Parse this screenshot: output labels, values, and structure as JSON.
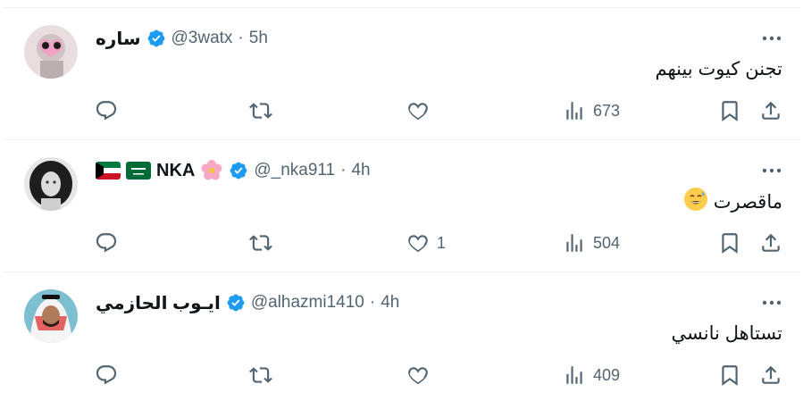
{
  "colors": {
    "text": "#0f1419",
    "secondary": "#536471",
    "verified": "#1d9bf0",
    "divider": "#eff3f4"
  },
  "tweets": [
    {
      "display_name": "ساره",
      "handle": "@3watx",
      "separator": "·",
      "time": "5h",
      "text": "تجنن كيوت بينهم",
      "likes": "",
      "views": "673"
    },
    {
      "display_name": "NKA",
      "name_flags": [
        "kuwait-flag",
        "saudi-flag"
      ],
      "name_emoji": "flower-icon",
      "handle": "@_nka911",
      "separator": "·",
      "time": "4h",
      "text": "ماقصرت",
      "text_emoji": "grinning-sweat-icon",
      "likes": "1",
      "views": "504"
    },
    {
      "display_name": "ايـوب الحازمي",
      "handle": "@alhazmi1410",
      "separator": "·",
      "time": "4h",
      "text": "تستاهل نانسي",
      "likes": "",
      "views": "409"
    }
  ]
}
